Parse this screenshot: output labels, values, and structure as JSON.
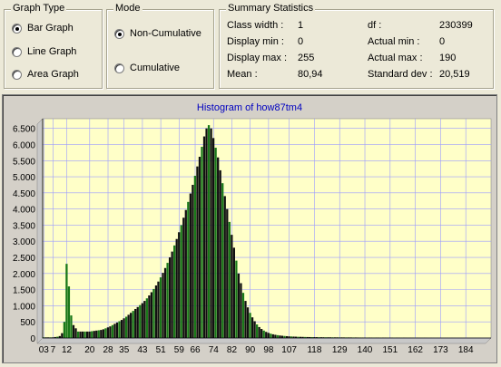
{
  "graph_type": {
    "title": "Graph Type",
    "options": [
      {
        "label": "Bar Graph",
        "checked": true
      },
      {
        "label": "Line Graph",
        "checked": false
      },
      {
        "label": "Area Graph",
        "checked": false
      }
    ]
  },
  "mode": {
    "title": "Mode",
    "options": [
      {
        "label": "Non-Cumulative",
        "checked": true
      },
      {
        "label": "Cumulative",
        "checked": false
      }
    ]
  },
  "summary": {
    "title": "Summary Statistics",
    "rows": [
      {
        "label": "Class width :",
        "value": "1",
        "label2": "df :",
        "value2": "230399"
      },
      {
        "label": "Display min :",
        "value": "0",
        "label2": "Actual min :",
        "value2": "0"
      },
      {
        "label": "Display max :",
        "value": "255",
        "label2": "Actual max :",
        "value2": "190"
      },
      {
        "label": "Mean :",
        "value": "80,94",
        "label2": "Standard dev :",
        "value2": "20,519"
      }
    ]
  },
  "colors": {
    "plot_bg": "#ffffc8",
    "grid": "#9b9bff",
    "bar_dark": "#101010",
    "bar_green": "#197819",
    "title": "#0000c0"
  },
  "chart_data": {
    "type": "bar",
    "title": "Histogram of how87tm4",
    "ylim": [
      0,
      6800
    ],
    "yticks": [
      "0",
      "500",
      "1.000",
      "1.500",
      "2.000",
      "2.500",
      "3.000",
      "3.500",
      "4.000",
      "4.500",
      "5.000",
      "5.500",
      "6.000",
      "6.500"
    ],
    "ytick_values": [
      0,
      500,
      1000,
      1500,
      2000,
      2500,
      3000,
      3500,
      4000,
      4500,
      5000,
      5500,
      6000,
      6500
    ],
    "xticks": [
      "03",
      "7",
      "12",
      "20",
      "28",
      "35",
      "43",
      "51",
      "59",
      "66",
      "74",
      "82",
      "90",
      "98",
      "107",
      "118",
      "129",
      "140",
      "151",
      "162",
      "173",
      "184"
    ],
    "xtick_values": [
      0,
      4,
      10,
      20,
      28,
      35,
      43,
      51,
      59,
      66,
      74,
      82,
      90,
      98,
      107,
      118,
      129,
      140,
      151,
      162,
      173,
      184
    ],
    "x": [
      0,
      1,
      2,
      3,
      4,
      5,
      6,
      7,
      8,
      9,
      10,
      11,
      12,
      13,
      14,
      15,
      16,
      17,
      18,
      19,
      20,
      21,
      22,
      23,
      24,
      25,
      26,
      27,
      28,
      29,
      30,
      31,
      32,
      33,
      34,
      35,
      36,
      37,
      38,
      39,
      40,
      41,
      42,
      43,
      44,
      45,
      46,
      47,
      48,
      49,
      50,
      51,
      52,
      53,
      54,
      55,
      56,
      57,
      58,
      59,
      60,
      61,
      62,
      63,
      64,
      65,
      66,
      67,
      68,
      69,
      70,
      71,
      72,
      73,
      74,
      75,
      76,
      77,
      78,
      79,
      80,
      81,
      82,
      83,
      84,
      85,
      86,
      87,
      88,
      89,
      90,
      91,
      92,
      93,
      94,
      95,
      96,
      97,
      98,
      99,
      100,
      101,
      102,
      103,
      104,
      105,
      106,
      107,
      108,
      109,
      110,
      111,
      112,
      113,
      114,
      115,
      116,
      117,
      118,
      119,
      120,
      121,
      122,
      123,
      124,
      125,
      126,
      127,
      128,
      129,
      130,
      131,
      132,
      133,
      134,
      135,
      136,
      137,
      138,
      139,
      140,
      141,
      142,
      143,
      144,
      145,
      146,
      147,
      148,
      149,
      150,
      151,
      152,
      153,
      154,
      155,
      156,
      157,
      158,
      159,
      160,
      161,
      162,
      163,
      164,
      165,
      166,
      167,
      168,
      169,
      170,
      171,
      172,
      173,
      174,
      175,
      176,
      177,
      178,
      179,
      180,
      181,
      182,
      183,
      184,
      185,
      186,
      187,
      188,
      189,
      190
    ],
    "values": [
      20,
      20,
      20,
      20,
      20,
      30,
      40,
      60,
      150,
      500,
      2300,
      1600,
      700,
      400,
      300,
      200,
      200,
      200,
      200,
      200,
      200,
      210,
      220,
      230,
      240,
      250,
      270,
      300,
      330,
      360,
      400,
      440,
      480,
      520,
      560,
      610,
      660,
      720,
      780,
      840,
      900,
      960,
      1020,
      1080,
      1150,
      1230,
      1320,
      1420,
      1520,
      1630,
      1750,
      1880,
      2020,
      2170,
      2330,
      2500,
      2680,
      2870,
      3070,
      3280,
      3500,
      3730,
      3970,
      4220,
      4480,
      4750,
      5030,
      5320,
      5620,
      5930,
      6250,
      6500,
      6600,
      6500,
      6200,
      5900,
      5600,
      5200,
      4800,
      4400,
      4000,
      3600,
      3200,
      2800,
      2400,
      2000,
      1700,
      1400,
      1150,
      950,
      780,
      640,
      520,
      420,
      340,
      280,
      230,
      190,
      160,
      135,
      115,
      100,
      88,
      78,
      70,
      63,
      57,
      52,
      48,
      44,
      41,
      38,
      36,
      34,
      32,
      30,
      29,
      28,
      27,
      26,
      25,
      24,
      23,
      22,
      22,
      21,
      21,
      20,
      20,
      19,
      19,
      18,
      18,
      17,
      17,
      16,
      16,
      15,
      15,
      14,
      14,
      13,
      13,
      12,
      12,
      12,
      11,
      11,
      11,
      10,
      10,
      10,
      9,
      9,
      9,
      8,
      8,
      8,
      7,
      7,
      7,
      6,
      6,
      6,
      5,
      5,
      5,
      4,
      4,
      4,
      3,
      3,
      3,
      3,
      2,
      2,
      2,
      2,
      2,
      2,
      1,
      1,
      1,
      1,
      1,
      1,
      1,
      1,
      1,
      1,
      1,
      1,
      1,
      1,
      1,
      1,
      1,
      1,
      1
    ]
  }
}
